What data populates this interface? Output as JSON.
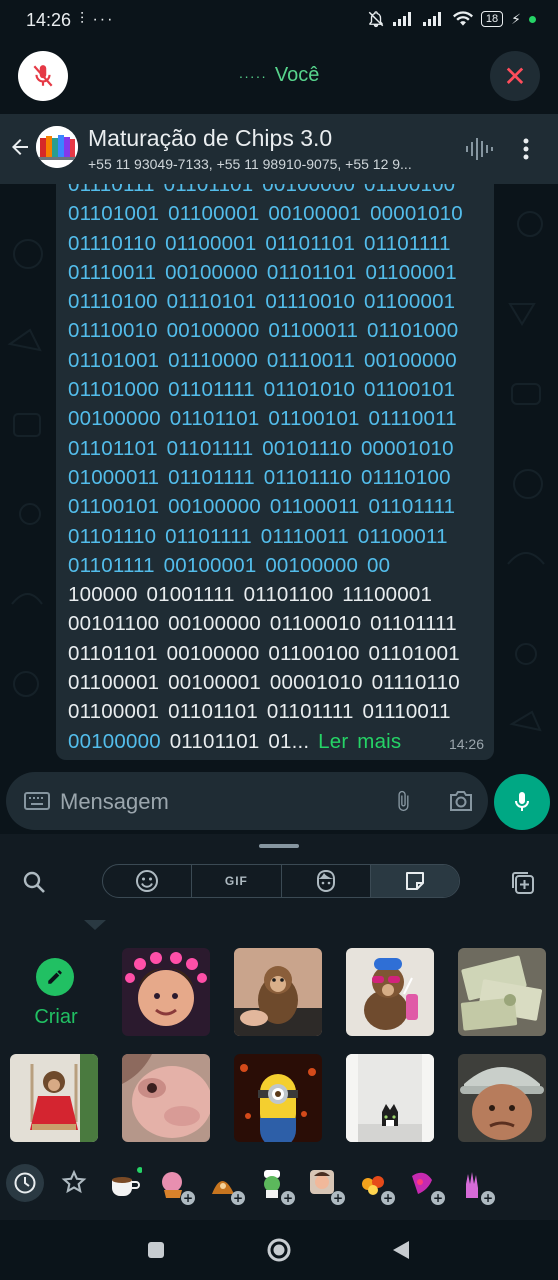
{
  "status_bar": {
    "time": "14:26",
    "left_icons": "⫶ ···",
    "battery": "18",
    "icons": [
      "bell-off-icon",
      "signal-1-icon",
      "signal-2-icon",
      "wifi-icon",
      "battery-icon",
      "charging-icon"
    ]
  },
  "call_bar": {
    "participant": "Você",
    "mute_icon": "mic-off-icon",
    "end_icon": "close-icon",
    "accent": "#57d38c"
  },
  "chat_header": {
    "group_name": "Maturação de Chips 3.0",
    "members": "+55 11 93049-7133, +55 11 98910-9075, +55 12 9...",
    "icons": [
      "back-arrow-icon",
      "group-avatar-books",
      "voice-wave-icon",
      "more-vert-icon"
    ]
  },
  "message": {
    "top_partial": "01110111 01101101 00100000 01100100",
    "link_lines": [
      "01101001 01100001 00100001 00001010",
      "01110110 01100001 01101101 01101111",
      "01110011 00100000 01101101 01100001",
      "01110100 01110101 01110010 01100001",
      "01110010 00100000 01100011 01101000",
      "01101001 01110000 01110011 00100000",
      "01101000 01101111 01101010 01100101",
      "00100000 01101101 01100101 01110011",
      "01101101 01101111 00101110 00001010",
      "01000011 01101111 01101110 01110100",
      "01100101 00100000 01100011 01101111",
      "01101110 01101111 01110011 01100011",
      "01101111 00100001 00100000 00"
    ],
    "plain_lines": [
      "100000 01001111 01101100 11100001",
      "00101100 00100000 01100010 01101111",
      "01101101 00100000 01100100 01101001",
      "01100001 00100001 00001010 01110110",
      "01100001 01101101 01101111 01110011"
    ],
    "last_link": "00100000",
    "last_plain": " 01101101 01...",
    "read_more": "Ler mais",
    "time": "14:26",
    "link_color": "#53bdeb",
    "read_more_color": "#25d366"
  },
  "input_bar": {
    "placeholder": "Mensagem",
    "icons": [
      "keyboard-icon",
      "attach-icon",
      "camera-icon",
      "mic-icon"
    ],
    "send_color": "#00a884"
  },
  "sticker_panel": {
    "tabs": [
      {
        "name": "emoji",
        "icon": "emoji-icon",
        "label": ""
      },
      {
        "name": "gif",
        "icon": "",
        "label": "GIF"
      },
      {
        "name": "avatar",
        "icon": "avatar-icon",
        "label": ""
      },
      {
        "name": "sticker",
        "icon": "sticker-icon",
        "label": ""
      }
    ],
    "active_tab": "sticker",
    "create_label": "Criar",
    "stickers": [
      "girl-hearts-sticker",
      "monkey-held-sticker",
      "monkey-sunglasses-drink-sticker",
      "money-bills-sticker",
      "monkey-red-dress-sticker",
      "monkey-closeup-sticker",
      "minion-sticker",
      "cat-peeking-sticker",
      "man-cap-sticker"
    ],
    "tray": [
      "recent-icon",
      "star-icon",
      "coffee-cup-sticker",
      "pack-2",
      "pack-3",
      "pack-4",
      "pack-5",
      "pack-6",
      "pack-7",
      "pack-8"
    ]
  },
  "nav_bar": {
    "icons": [
      "recents-square-icon",
      "home-circle-icon",
      "back-triangle-icon"
    ]
  }
}
